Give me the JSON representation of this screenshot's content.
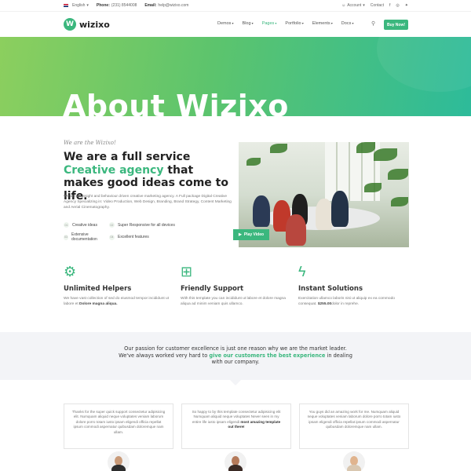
{
  "topbar": {
    "language": "English",
    "phone_label": "Phone:",
    "phone_value": "(231) 8544008",
    "email_label": "Email:",
    "email_value": "help@wizixo.com",
    "account": "Account",
    "contact": "Contact"
  },
  "nav": {
    "logo_mark": "W",
    "logo_text": "wizixo",
    "menu": [
      "Demos",
      "Blog",
      "Pages",
      "Portfolio",
      "Elements",
      "Docs"
    ],
    "active_item": "Pages",
    "buy_label": "Buy Now!"
  },
  "hero": {
    "title": "About Wizixo"
  },
  "about": {
    "eyebrow": "We are the Wizixo!",
    "headline_part1": "We are a full service ",
    "headline_accent": "Creative agency",
    "headline_part2": " that makes good ideas come to life.",
    "lead": "We are an insight and behaviour driven creative marketing agency. A Full package Digital Creative Agency Specializing in: Video Production, Web Design, Branding, Brand Strategy, Content Marketing and Aerial Cinematography.",
    "features": [
      {
        "num": "01",
        "label": "Creative ideas"
      },
      {
        "num": "02",
        "label": "Super Responsive for all devices"
      },
      {
        "num": "03",
        "label": "Extensive documentation"
      },
      {
        "num": "04",
        "label": "Excellent features"
      }
    ],
    "play_label": "Play Video"
  },
  "services": [
    {
      "title": "Unlimited Helpers",
      "text_before": "We have vast collection of sed do eiusmod tempor incididunt ut labore et ",
      "text_bold": "Dolore magna aliqua.",
      "text_after": ""
    },
    {
      "title": "Friendly Support",
      "text_before": "With this template you can incididunt ut labore et dolore magna aliqua ad minim veniam quis ullamco.",
      "text_bold": "",
      "text_after": ""
    },
    {
      "title": "Instant Solutions",
      "text_before": "Exercitation ullamco laboris nisi ut aliquip ex ea commodo consequat. ",
      "text_bold": "$255.00",
      "text_after": "dolor in reprehe."
    }
  ],
  "passion": {
    "line1": "Our passion for customer excellence is just one reason why we are the market leader.",
    "line2_before": "We've always worked very hard to ",
    "line2_accent": "give our customers the best experience",
    "line2_after": " in dealing with our company."
  },
  "testimonials": [
    {
      "before": "Thanks for the super quick support consectetur adipisicing elit. Numquam aliquid neque voluptates veniam laborum dolore porro totam iusto ipsam eligendi officia repellat ipsum commodi aspernatur quibusdam doloremque nam ullam.",
      "bold": "",
      "after": ""
    },
    {
      "before": "So happy to by this template consectetur adipisicing elit Numquam aliquid neque voluptates Never seen in my entire life iusto ipsam eligendi ",
      "bold": "most amazing template out there!",
      "after": ""
    },
    {
      "before": "You guys did an amazing work for me. Numquam aliquid neque voluptates veniam laborum dolore porro totam iusto ipsam eligendi officia repellat ipsum commodi aspernatur quibusdam doloremque nam ullam.",
      "bold": "",
      "after": ""
    }
  ],
  "colors": {
    "accent": "#3bb77e",
    "hero_start": "#8ccf5e",
    "hero_end": "#2dbb9a",
    "band": "#f3f4f7"
  },
  "icons": [
    "user-icon",
    "facebook-icon",
    "instagram-icon",
    "twitter-icon",
    "search-icon",
    "play-icon",
    "gear-icon",
    "support-box-icon",
    "lightning-icon"
  ]
}
